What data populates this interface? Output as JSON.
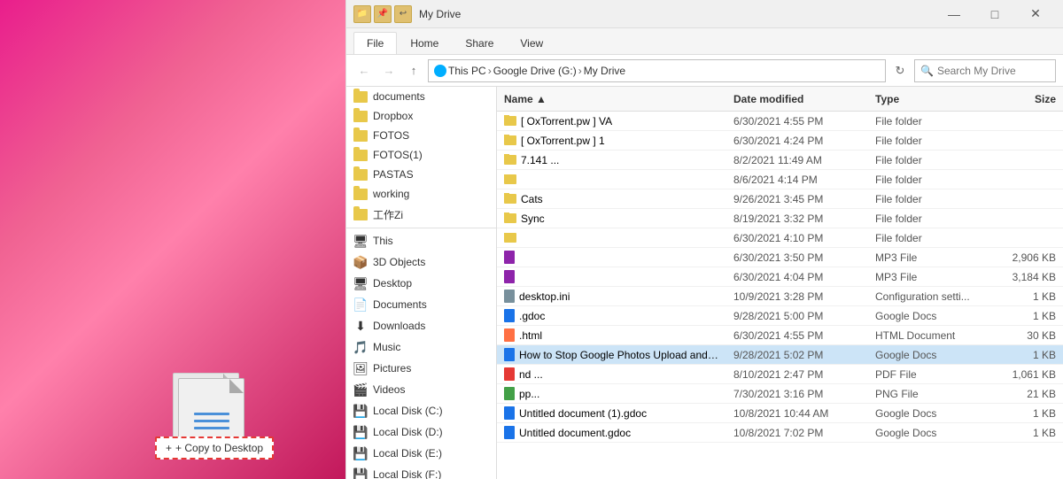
{
  "bg": {
    "drag_label": "+ Copy to Desktop"
  },
  "titleBar": {
    "title": "My Drive",
    "minimize": "—",
    "maximize": "□",
    "close": "✕"
  },
  "ribbonTabs": [
    "File",
    "Home",
    "Share",
    "View"
  ],
  "activeTab": "File",
  "addressBar": {
    "back": "←",
    "forward": "→",
    "up": "↑",
    "path": [
      "This PC",
      "Google Drive (G:)",
      "My Drive"
    ],
    "searchPlaceholder": "Search My Drive"
  },
  "sidebar": {
    "items": [
      {
        "label": "documents",
        "type": "folder"
      },
      {
        "label": "Dropbox",
        "type": "folder"
      },
      {
        "label": "FOTOS",
        "type": "folder"
      },
      {
        "label": "FOTOS(1)",
        "type": "folder"
      },
      {
        "label": "PASTAS",
        "type": "folder"
      },
      {
        "label": "working",
        "type": "folder"
      },
      {
        "label": "工作Zi",
        "type": "folder"
      },
      {
        "label": "This PC",
        "type": "pc"
      },
      {
        "label": "3D Objects",
        "type": "special"
      },
      {
        "label": "Desktop",
        "type": "special"
      },
      {
        "label": "Documents",
        "type": "special"
      },
      {
        "label": "Downloads",
        "type": "special"
      },
      {
        "label": "Music",
        "type": "special"
      },
      {
        "label": "Pictures",
        "type": "special"
      },
      {
        "label": "Videos",
        "type": "special"
      },
      {
        "label": "Local Disk (C:)",
        "type": "disk"
      },
      {
        "label": "Local Disk (D:)",
        "type": "disk"
      },
      {
        "label": "Local Disk (E:)",
        "type": "disk"
      },
      {
        "label": "Local Disk (F:)",
        "type": "disk"
      }
    ]
  },
  "fileList": {
    "headers": {
      "name": "Name",
      "dateModified": "Date modified",
      "type": "Type",
      "size": "Size"
    },
    "files": [
      {
        "name": "[ OxTorrent.pw ] VA",
        "date": "6/30/2021 4:55 PM",
        "type": "File folder",
        "size": "",
        "icon": "folder"
      },
      {
        "name": "[ OxTorrent.pw ] 1",
        "date": "6/30/2021 4:24 PM",
        "type": "File folder",
        "size": "",
        "icon": "folder"
      },
      {
        "name": "7.141 ...",
        "date": "8/2/2021 11:49 AM",
        "type": "File folder",
        "size": "",
        "icon": "folder"
      },
      {
        "name": "",
        "date": "8/6/2021 4:14 PM",
        "type": "File folder",
        "size": "",
        "icon": "folder"
      },
      {
        "name": "Cats",
        "date": "9/26/2021 3:45 PM",
        "type": "File folder",
        "size": "",
        "icon": "folder"
      },
      {
        "name": "Sync",
        "date": "8/19/2021 3:32 PM",
        "type": "File folder",
        "size": "",
        "icon": "folder"
      },
      {
        "name": "",
        "date": "6/30/2021 4:10 PM",
        "type": "File folder",
        "size": "",
        "icon": "folder"
      },
      {
        "name": "",
        "date": "6/30/2021 3:50 PM",
        "type": "MP3 File",
        "size": "2,906 KB",
        "icon": "mp3"
      },
      {
        "name": "",
        "date": "6/30/2021 4:04 PM",
        "type": "MP3 File",
        "size": "3,184 KB",
        "icon": "mp3"
      },
      {
        "name": "desktop.ini",
        "date": "10/9/2021 3:28 PM",
        "type": "Configuration setti...",
        "size": "1 KB",
        "icon": "ini"
      },
      {
        "name": ".gdoc",
        "date": "9/28/2021 5:00 PM",
        "type": "Google Docs",
        "size": "1 KB",
        "icon": "gdoc"
      },
      {
        "name": ".html",
        "date": "6/30/2021 4:55 PM",
        "type": "HTML Document",
        "size": "30 KB",
        "icon": "html"
      },
      {
        "name": "How to Stop Google Photos Upload and ...",
        "date": "9/28/2021 5:02 PM",
        "type": "Google Docs",
        "size": "1 KB",
        "icon": "gdoc",
        "selected": true
      },
      {
        "name": "nd ...",
        "date": "8/10/2021 2:47 PM",
        "type": "PDF File",
        "size": "1,061 KB",
        "icon": "pdf"
      },
      {
        "name": "pp...",
        "date": "7/30/2021 3:16 PM",
        "type": "PNG File",
        "size": "21 KB",
        "icon": "png"
      },
      {
        "name": "Untitled document (1).gdoc",
        "date": "10/8/2021 10:44 AM",
        "type": "Google Docs",
        "size": "1 KB",
        "icon": "gdoc"
      },
      {
        "name": "Untitled document.gdoc",
        "date": "10/8/2021 7:02 PM",
        "type": "Google Docs",
        "size": "1 KB",
        "icon": "gdoc"
      }
    ]
  }
}
